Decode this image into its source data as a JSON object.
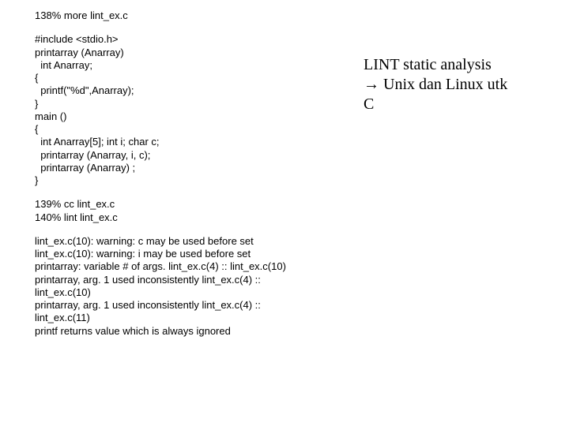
{
  "left": {
    "cmd1": "138% more lint_ex.c",
    "code": "#include <stdio.h>\nprintarray (Anarray)\n  int Anarray;\n{\n  printf(\"%d\",Anarray);\n}\nmain ()\n{\n  int Anarray[5]; int i; char c;\n  printarray (Anarray, i, c);\n  printarray (Anarray) ;\n}",
    "cmd2": "139% cc lint_ex.c\n140% lint lint_ex.c",
    "out": "lint_ex.c(10): warning: c may be used before set\nlint_ex.c(10): warning: i may be used before set\nprintarray: variable # of args. lint_ex.c(4) :: lint_ex.c(10)\nprintarray, arg. 1 used inconsistently lint_ex.c(4) ::\nlint_ex.c(10)\nprintarray, arg. 1 used inconsistently lint_ex.c(4) ::\nlint_ex.c(11)\nprintf returns value which is always ignored"
  },
  "right": {
    "l1": "LINT static analysis",
    "arrow": "→",
    "l2a": " Unix dan Linux utk",
    "l3": "C"
  }
}
